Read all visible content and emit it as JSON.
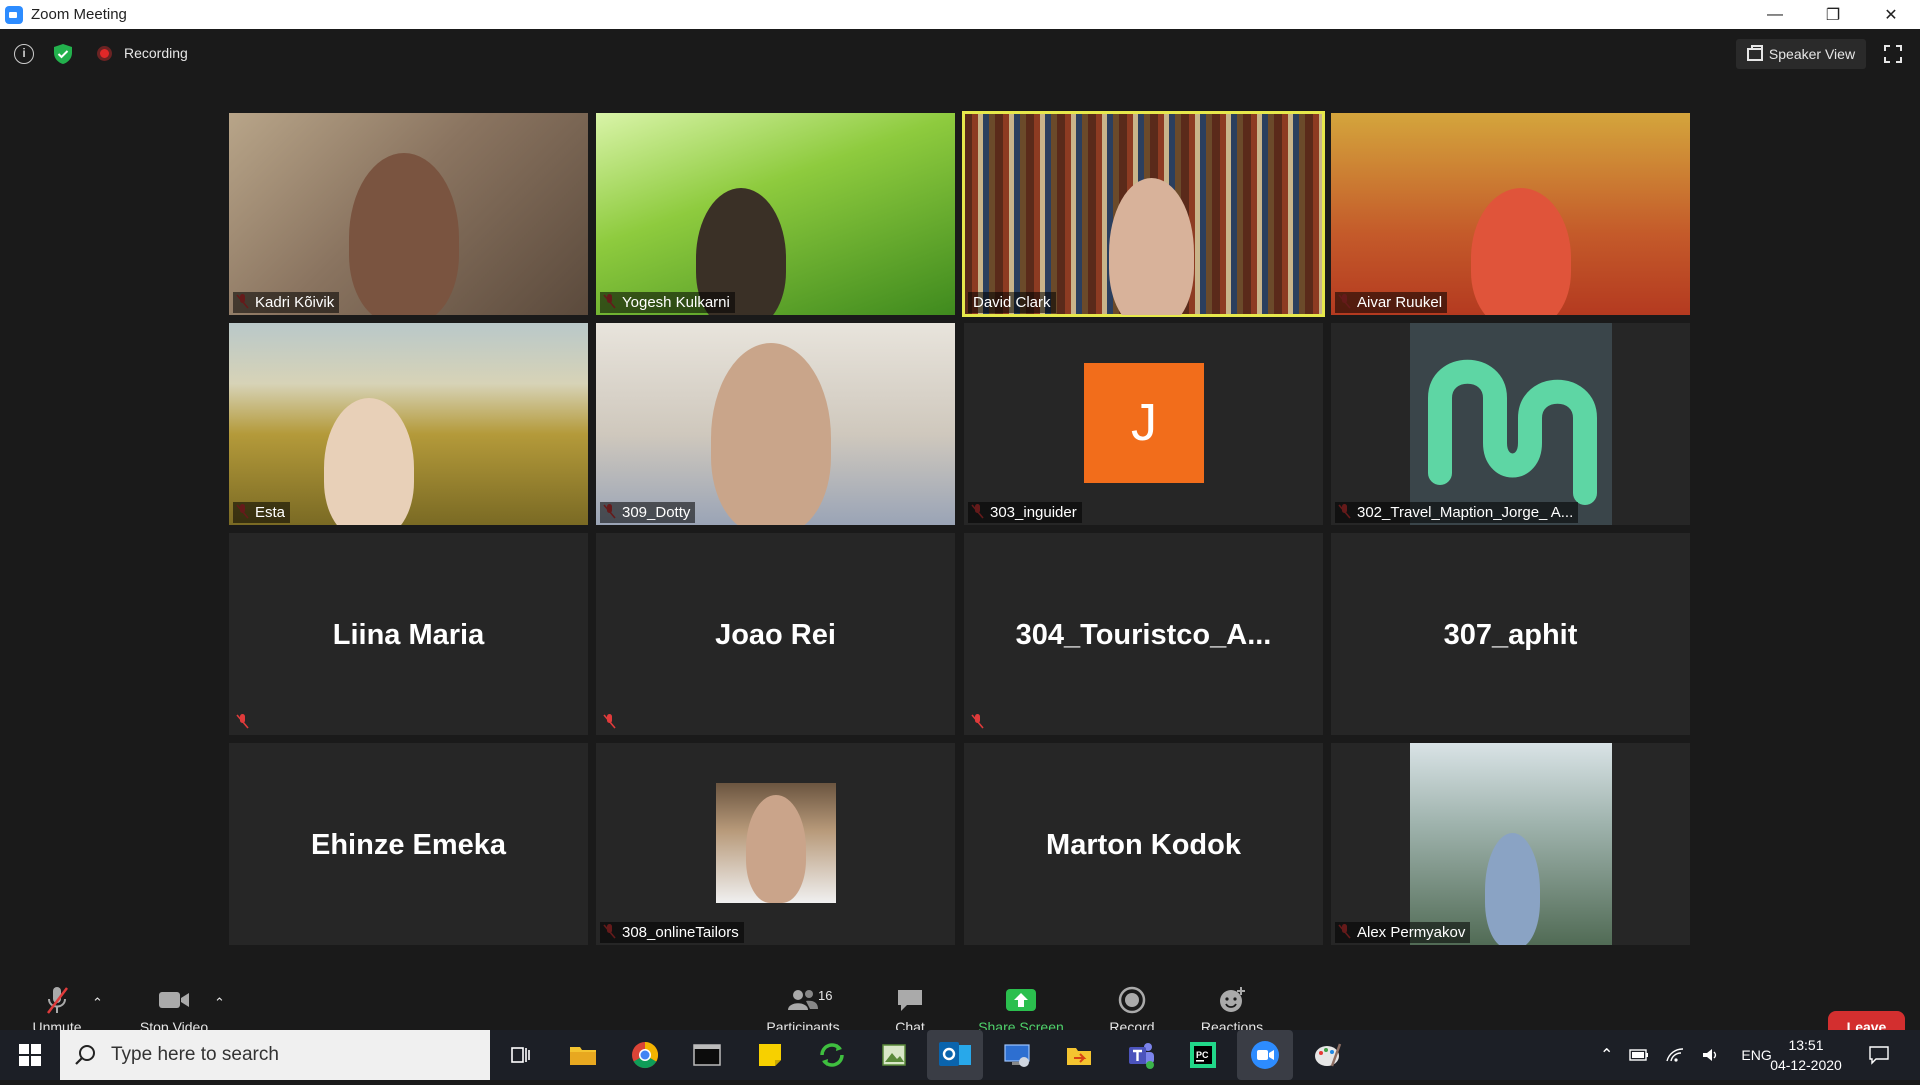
{
  "window": {
    "title": "Zoom Meeting",
    "minimize": "—",
    "restore": "❐",
    "close": "✕"
  },
  "topbar": {
    "recording_label": "Recording",
    "view_label": "Speaker View"
  },
  "tiles": [
    {
      "name": "Kadri Kõivik",
      "muted": true
    },
    {
      "name": "Yogesh Kulkarni",
      "muted": true
    },
    {
      "name": "David Clark",
      "muted": false,
      "active": true
    },
    {
      "name": "Aivar Ruukel",
      "muted": true
    },
    {
      "name": "Esta",
      "muted": true
    },
    {
      "name": "309_Dotty",
      "muted": true
    },
    {
      "name": "303_inguider",
      "muted": true,
      "avatar_letter": "J"
    },
    {
      "name": "302_Travel_Maption_Jorge_ A...",
      "muted": true
    },
    {
      "name": "Liina Maria",
      "muted": true
    },
    {
      "name": "Joao Rei",
      "muted": true
    },
    {
      "name": "304_Touristco_A...",
      "muted": true
    },
    {
      "name": "307_aphit",
      "muted": false
    },
    {
      "name": "Ehinze Emeka",
      "muted": false
    },
    {
      "name": "308_onlineTailors",
      "muted": true
    },
    {
      "name": "Marton Kodok",
      "muted": false
    },
    {
      "name": "Alex Permyakov",
      "muted": true
    }
  ],
  "controls": {
    "unmute": "Unmute",
    "stop_video": "Stop Video",
    "participants": "Participants",
    "participants_count": "16",
    "chat": "Chat",
    "share_screen": "Share Screen",
    "record": "Record",
    "reactions": "Reactions",
    "leave": "Leave"
  },
  "taskbar": {
    "search_placeholder": "Type here to search",
    "language": "ENG",
    "time": "13:51",
    "date": "04-12-2020"
  },
  "colors": {
    "share_green": "#4fd16b",
    "leave_red": "#d32f2f",
    "active_speaker": "#e6e84b",
    "avatar_orange": "#f26d1b",
    "logo_mint": "#5ed6a4"
  }
}
